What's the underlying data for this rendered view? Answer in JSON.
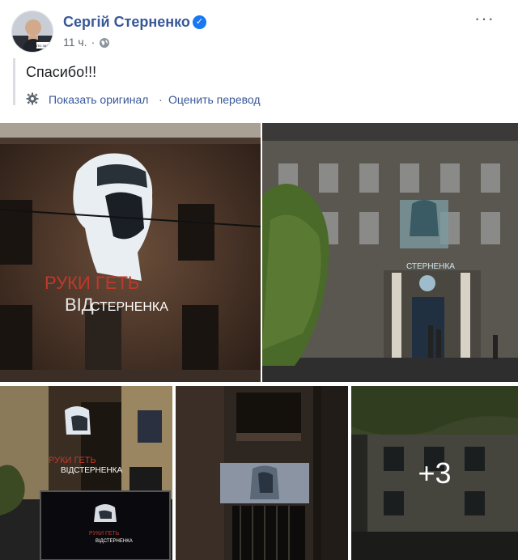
{
  "post": {
    "author": "Сергій Стерненко",
    "time": "11 ч.",
    "dot": "·",
    "text": "Спасибо!!!",
    "show_original": "Показать оригинал",
    "separator": "·",
    "rate_translation": "Оценить перевод"
  },
  "photos": {
    "main_left_text_red": "РУКИ ГЕТЬ",
    "main_left_text_white1": "ВІД",
    "main_left_text_white2": "СТЕРНЕНКА",
    "main_right_text": "СТЕРНЕНКА",
    "bottom_left_text_red": "РУКИ ГЕТЬ",
    "bottom_left_text_white": "ВІДСТЕРНЕНКА",
    "bottom_left_text_red2": "РУКИ ГЕТЬ",
    "bottom_left_text_white2": "ВІДСТЕРНЕНКА",
    "more_count": "+3"
  },
  "colors": {
    "link": "#385898",
    "verified": "#1877f2"
  }
}
